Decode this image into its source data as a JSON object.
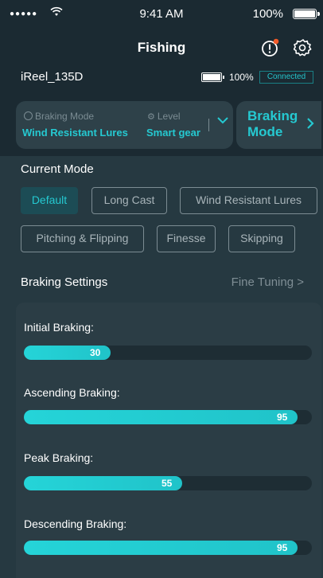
{
  "status": {
    "signal": "●●●●●",
    "time": "9:41 AM",
    "battery": "100%"
  },
  "nav": {
    "title": "Fishing",
    "alert_icon": "alert-circle-icon",
    "settings_icon": "gear-icon"
  },
  "device": {
    "name": "iReel_135D",
    "battery": "100%",
    "status": "Connected"
  },
  "mode_card": {
    "braking_mode_label": "Braking Mode",
    "braking_mode_value": "Wind Resistant Lures",
    "level_label": "Level",
    "level_value": "Smart gear",
    "button_label": "Braking Mode"
  },
  "current_mode": {
    "title": "Current Mode",
    "options": [
      "Default",
      "Long Cast",
      "Wind Resistant Lures",
      "Pitching & Flipping",
      "Finesse",
      "Skipping"
    ],
    "selected": "Default"
  },
  "braking_settings": {
    "title": "Braking Settings",
    "link": "Fine Tuning",
    "sliders": [
      {
        "label": "Initial Braking:",
        "value": 30,
        "display": "30"
      },
      {
        "label": "Ascending Braking:",
        "value": 95,
        "display": "95"
      },
      {
        "label": "Peak Braking:",
        "value": 55,
        "display": "55"
      },
      {
        "label": "Descending Braking:",
        "value": 95,
        "display": "95"
      }
    ]
  },
  "colors": {
    "accent": "#25c9d1",
    "background": "#1b2a32",
    "panel": "#263941",
    "alert_dot": "#f05a28"
  }
}
